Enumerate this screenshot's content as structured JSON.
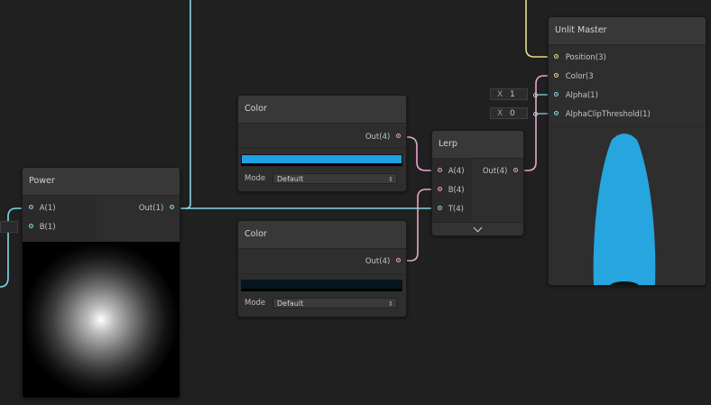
{
  "colors": {
    "background": "#202020",
    "wire_cyan": "#82d6e6",
    "wire_pink": "#e6a8cc",
    "wire_yellow": "#e2dc84",
    "color1": "#1ea0e6",
    "color2": "#03161f",
    "preview_shape": "#27a5de"
  },
  "power": {
    "title": "Power",
    "inputs": [
      "A(1)",
      "B(1)"
    ],
    "output": "Out(1)"
  },
  "color1": {
    "title": "Color",
    "output": "Out(4)",
    "mode_label": "Mode",
    "mode_value": "Default"
  },
  "color2": {
    "title": "Color",
    "output": "Out(4)",
    "mode_label": "Mode",
    "mode_value": "Default"
  },
  "lerp": {
    "title": "Lerp",
    "inputs": [
      "A(4)",
      "B(4)",
      "T(4)"
    ],
    "output": "Out(4)",
    "expand_icon": "chevron-down-icon"
  },
  "master": {
    "title": "Unlit Master",
    "inputs": [
      "Position(3)",
      "Color(3",
      "Alpha(1)",
      "AlphaClipThreshold(1)"
    ]
  },
  "alpha_field": {
    "label": "X",
    "value": "1"
  },
  "clip_field": {
    "label": "X",
    "value": "0"
  }
}
